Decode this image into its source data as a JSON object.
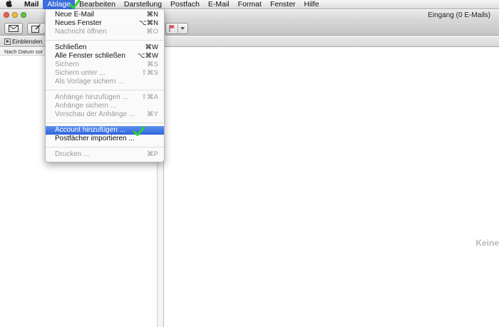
{
  "menubar": {
    "app_name": "Mail",
    "items": [
      "Ablage",
      "Bearbeiten",
      "Darstellung",
      "Postfach",
      "E-Mail",
      "Format",
      "Fenster",
      "Hilfe"
    ],
    "active": "Ablage"
  },
  "window": {
    "title": "Eingang (0 E-Mails)"
  },
  "favorites_bar": {
    "show_label": "Einblenden"
  },
  "message_list": {
    "sort_label": "Nach Datum sor"
  },
  "viewer": {
    "empty_label": "Keine"
  },
  "file_menu": {
    "groups": [
      [
        {
          "label": "Neue E-Mail",
          "shortcut": "⌘N",
          "enabled": true
        },
        {
          "label": "Neues Fenster",
          "shortcut": "⌥⌘N",
          "enabled": true
        },
        {
          "label": "Nachricht öffnen",
          "shortcut": "⌘O",
          "enabled": false
        }
      ],
      [
        {
          "label": "Schließen",
          "shortcut": "⌘W",
          "enabled": true
        },
        {
          "label": "Alle Fenster schließen",
          "shortcut": "⌥⌘W",
          "enabled": true
        },
        {
          "label": "Sichern",
          "shortcut": "⌘S",
          "enabled": false
        },
        {
          "label": "Sichern unter ...",
          "shortcut": "⇧⌘S",
          "enabled": false
        },
        {
          "label": "Als Vorlage sichern ...",
          "shortcut": "",
          "enabled": false
        }
      ],
      [
        {
          "label": "Anhänge hinzufügen ...",
          "shortcut": "⇧⌘A",
          "enabled": false
        },
        {
          "label": "Anhänge sichern ...",
          "shortcut": "",
          "enabled": false
        },
        {
          "label": "Vorschau der Anhänge ...",
          "shortcut": "⌘Y",
          "enabled": false
        }
      ],
      [
        {
          "label": "Account hinzufügen ...",
          "shortcut": "",
          "enabled": true,
          "highlighted": true
        },
        {
          "label": "Postfächer importieren ...",
          "shortcut": "",
          "enabled": true
        }
      ],
      [
        {
          "label": "Drucken ...",
          "shortcut": "⌘P",
          "enabled": false
        }
      ]
    ]
  },
  "colors": {
    "highlight": "#2f64dc",
    "check_mark": "#2fd52f"
  },
  "icons": [
    "apple-icon",
    "compose-icon",
    "new-message-icon",
    "flag-icon",
    "dropdown-arrow-icon",
    "check-mark-icon",
    "disclosure-triangle-icon"
  ]
}
